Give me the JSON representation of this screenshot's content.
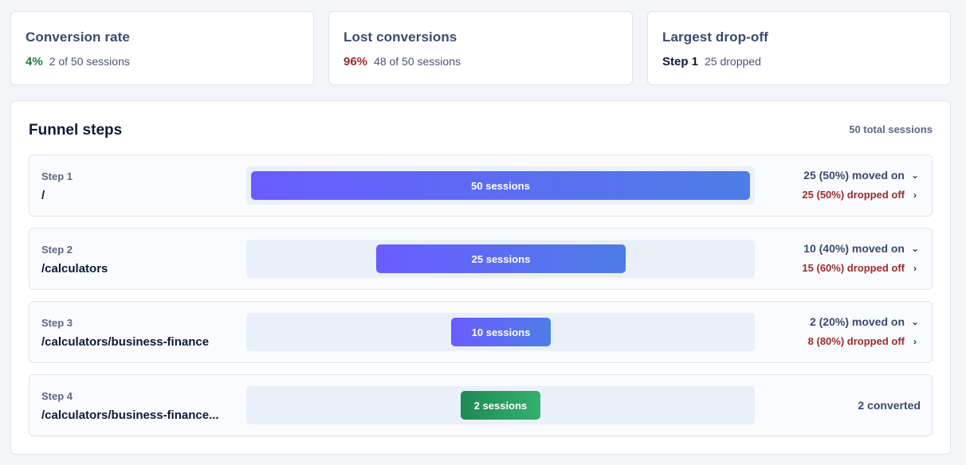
{
  "stats": [
    {
      "title": "Conversion rate",
      "big": "4%",
      "sub": "2 of 50 sessions",
      "color": "#1e7a46"
    },
    {
      "title": "Lost conversions",
      "big": "96%",
      "sub": "48 of 50 sessions",
      "color": "#9e2a2a"
    },
    {
      "title": "Largest drop-off",
      "big": "Step 1",
      "sub": "25 dropped",
      "color": "#0e1a3a"
    }
  ],
  "funnel": {
    "title": "Funnel steps",
    "total": "50 total sessions",
    "total_sessions": 50,
    "steps": [
      {
        "label": "Step 1",
        "path": "/",
        "sessions": 50,
        "bar_label": "50 sessions",
        "moved": "25 (50%) moved on",
        "dropped": "25 (50%) dropped off"
      },
      {
        "label": "Step 2",
        "path": "/calculators",
        "sessions": 25,
        "bar_label": "25 sessions",
        "moved": "10 (40%) moved on",
        "dropped": "15 (60%) dropped off"
      },
      {
        "label": "Step 3",
        "path": "/calculators/business-finance",
        "sessions": 10,
        "bar_label": "10 sessions",
        "moved": "2 (20%) moved on",
        "dropped": "8 (80%) dropped off"
      },
      {
        "label": "Step 4",
        "path": "/calculators/business-finance...",
        "sessions": 2,
        "bar_label": "2 sessions",
        "converted": "2 converted"
      }
    ]
  },
  "icons": {
    "expand": "chevron-down-icon",
    "open": "chevron-right-icon"
  }
}
